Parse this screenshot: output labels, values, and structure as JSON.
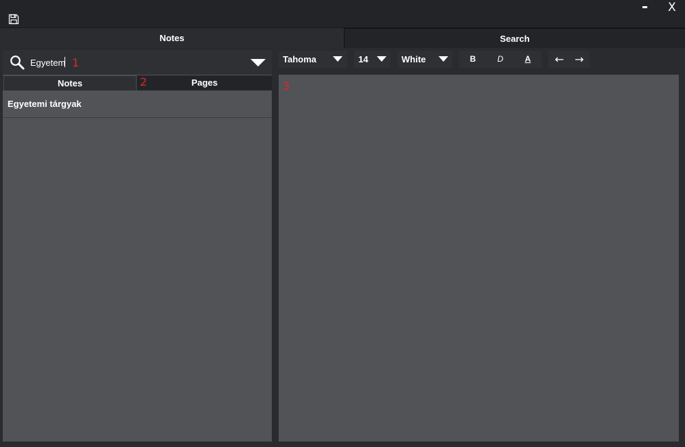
{
  "window": {
    "close_label": "X"
  },
  "main_tabs": [
    {
      "label": "Notes"
    },
    {
      "label": "Search"
    }
  ],
  "search": {
    "value": "Egyetem",
    "annotation": "1"
  },
  "sub_tabs": {
    "items": [
      {
        "label": "Notes"
      },
      {
        "label": "Pages"
      }
    ],
    "annotation": "2"
  },
  "list": {
    "items": [
      {
        "label": "Egyetemi tárgyak"
      }
    ]
  },
  "toolbar": {
    "font": "Tahoma",
    "size": "14",
    "color": "White",
    "bold": "B",
    "italic": "D",
    "underline": "A",
    "undo": "←",
    "redo": "→"
  },
  "editor": {
    "annotation": "3"
  },
  "colors": {
    "background": "#2a2b2f",
    "panel": "#515357",
    "annotation": "#e0262b"
  }
}
